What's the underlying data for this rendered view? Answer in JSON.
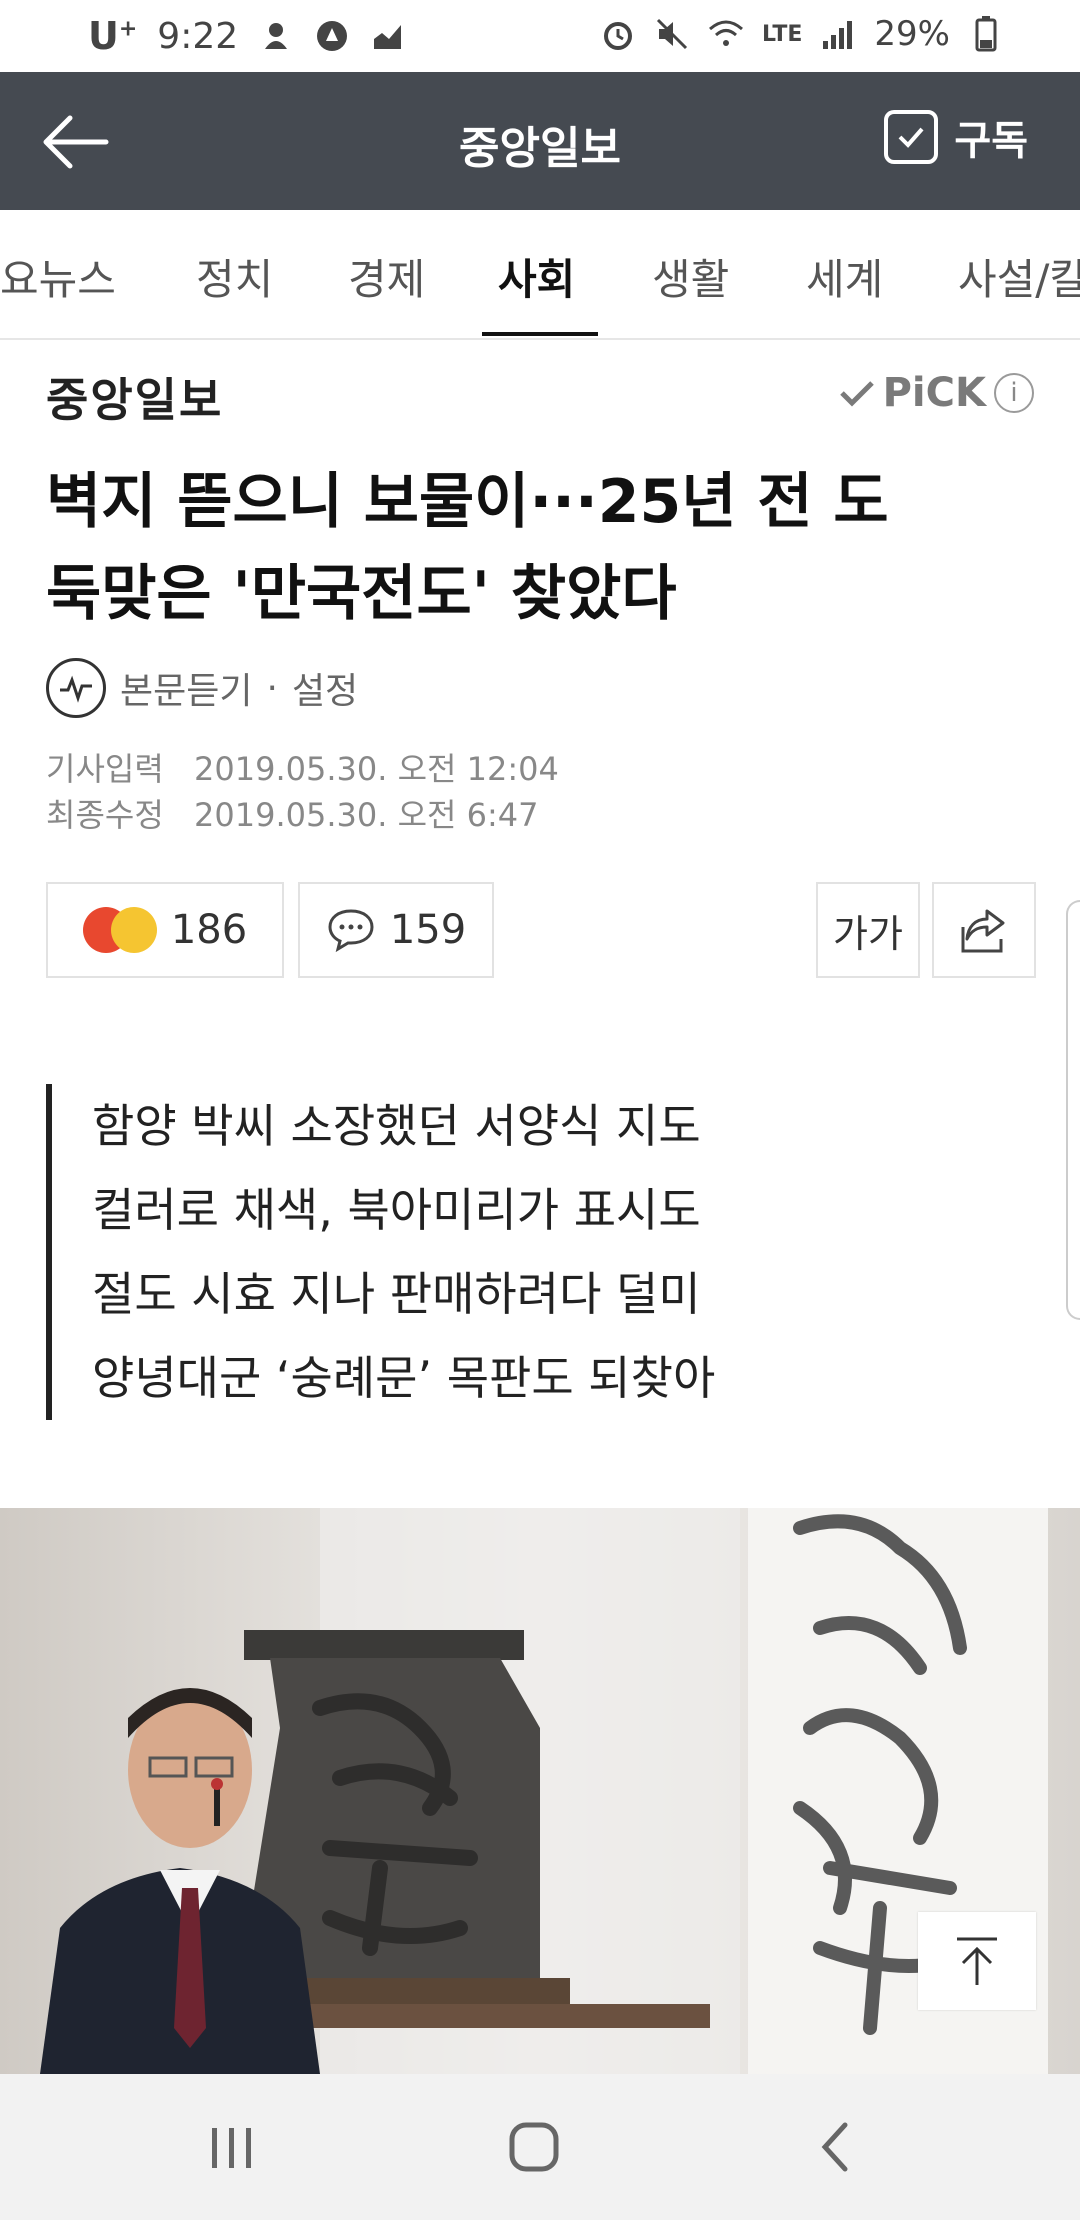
{
  "status_bar": {
    "carrier": "U",
    "carrier_sup": "+",
    "time": "9:22",
    "network": "LTE",
    "battery": "29%"
  },
  "app_bar": {
    "title": "중앙일보",
    "subscribe_label": "구독"
  },
  "tabs": [
    {
      "label": "요뉴스"
    },
    {
      "label": "정치"
    },
    {
      "label": "경제"
    },
    {
      "label": "사회",
      "active": true
    },
    {
      "label": "생활"
    },
    {
      "label": "세계"
    },
    {
      "label": "사설/칼"
    }
  ],
  "article": {
    "source": "중앙일보",
    "pick_label": "PiCK",
    "pick_info": "i",
    "headline_line1": "벽지 뜯으니 보물이···25년 전 도",
    "headline_line2": "둑맞은 '만국전도' 찾았다",
    "listen_label": "본문듣기",
    "listen_separator": "·",
    "settings_label": "설정",
    "published_label": "기사입력",
    "published_value": "2019.05.30. 오전 12:04",
    "modified_label": "최종수정",
    "modified_value": "2019.05.30. 오전 6:47",
    "reaction_count": "186",
    "comment_count": "159",
    "font_size_label": "가가",
    "summary": [
      "함양 박씨 소장했던 서양식 지도",
      "컬러로 채색, 북아미리가 표시도",
      "절도 시효 지나 판매하려다 덜미",
      "양녕대군 ‘숭례문’ 목판도 되찾아"
    ]
  },
  "colors": {
    "app_bar_bg": "#454a51",
    "angry_emoji": "#e8482f",
    "laugh_emoji": "#f5c531"
  }
}
